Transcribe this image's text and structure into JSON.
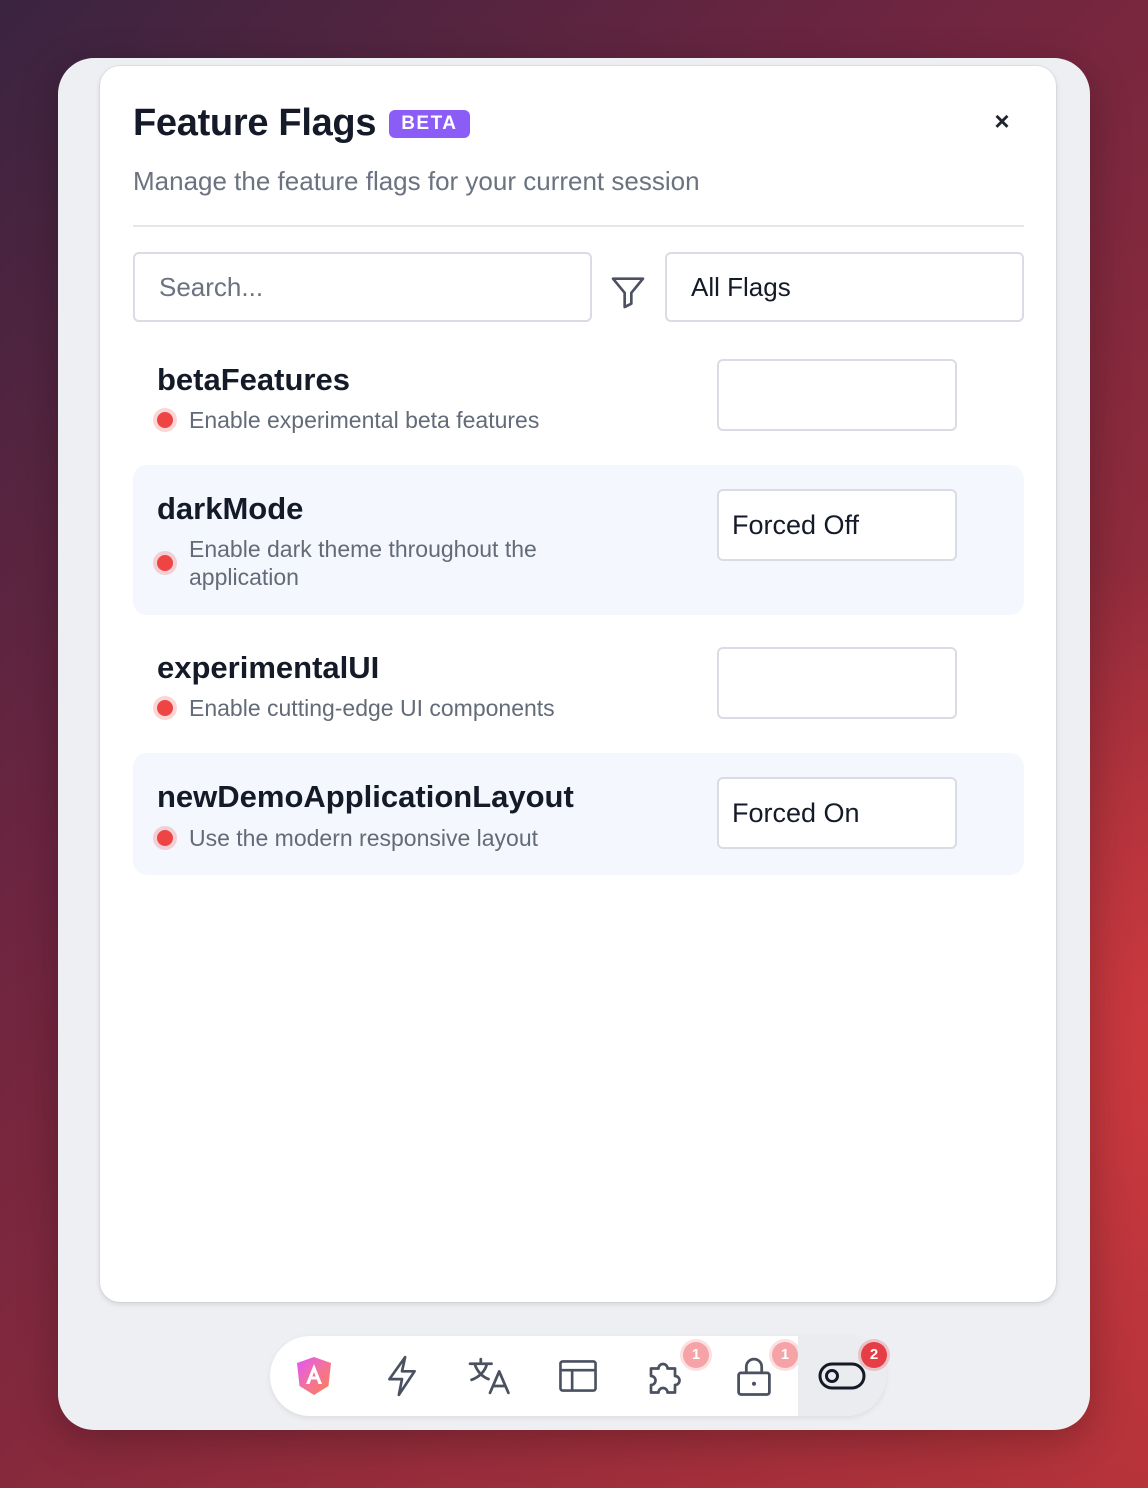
{
  "panel": {
    "title": "Feature Flags",
    "badge": "BETA",
    "close_label": "×",
    "subtitle": "Manage the feature flags for your current session"
  },
  "search": {
    "placeholder": "Search...",
    "value": ""
  },
  "filter": {
    "icon": "filter-icon",
    "selected": "All Flags"
  },
  "flags": [
    {
      "name": "betaFeatures",
      "description": "Enable experimental beta features",
      "status_color": "#ef4444",
      "value": ""
    },
    {
      "name": "darkMode",
      "description": "Enable dark theme throughout the application",
      "status_color": "#ef4444",
      "value": "Forced Off"
    },
    {
      "name": "experimentalUI",
      "description": "Enable cutting-edge UI components",
      "status_color": "#ef4444",
      "value": ""
    },
    {
      "name": "newDemoApplicationLayout",
      "description": "Use the modern responsive layout",
      "status_color": "#ef4444",
      "value": "Forced On"
    }
  ],
  "toolbar": {
    "items": [
      {
        "icon": "angular-logo-icon",
        "badge": ""
      },
      {
        "icon": "lightning-icon",
        "badge": ""
      },
      {
        "icon": "translate-icon",
        "badge": ""
      },
      {
        "icon": "layout-icon",
        "badge": ""
      },
      {
        "icon": "puzzle-icon",
        "badge": "1"
      },
      {
        "icon": "lock-icon",
        "badge": "1"
      },
      {
        "icon": "toggle-icon",
        "badge": "2",
        "active": true
      }
    ]
  },
  "colors": {
    "accent": "#8b5cf6",
    "status_off": "#ef4444",
    "badge_red": "#e53e46"
  }
}
